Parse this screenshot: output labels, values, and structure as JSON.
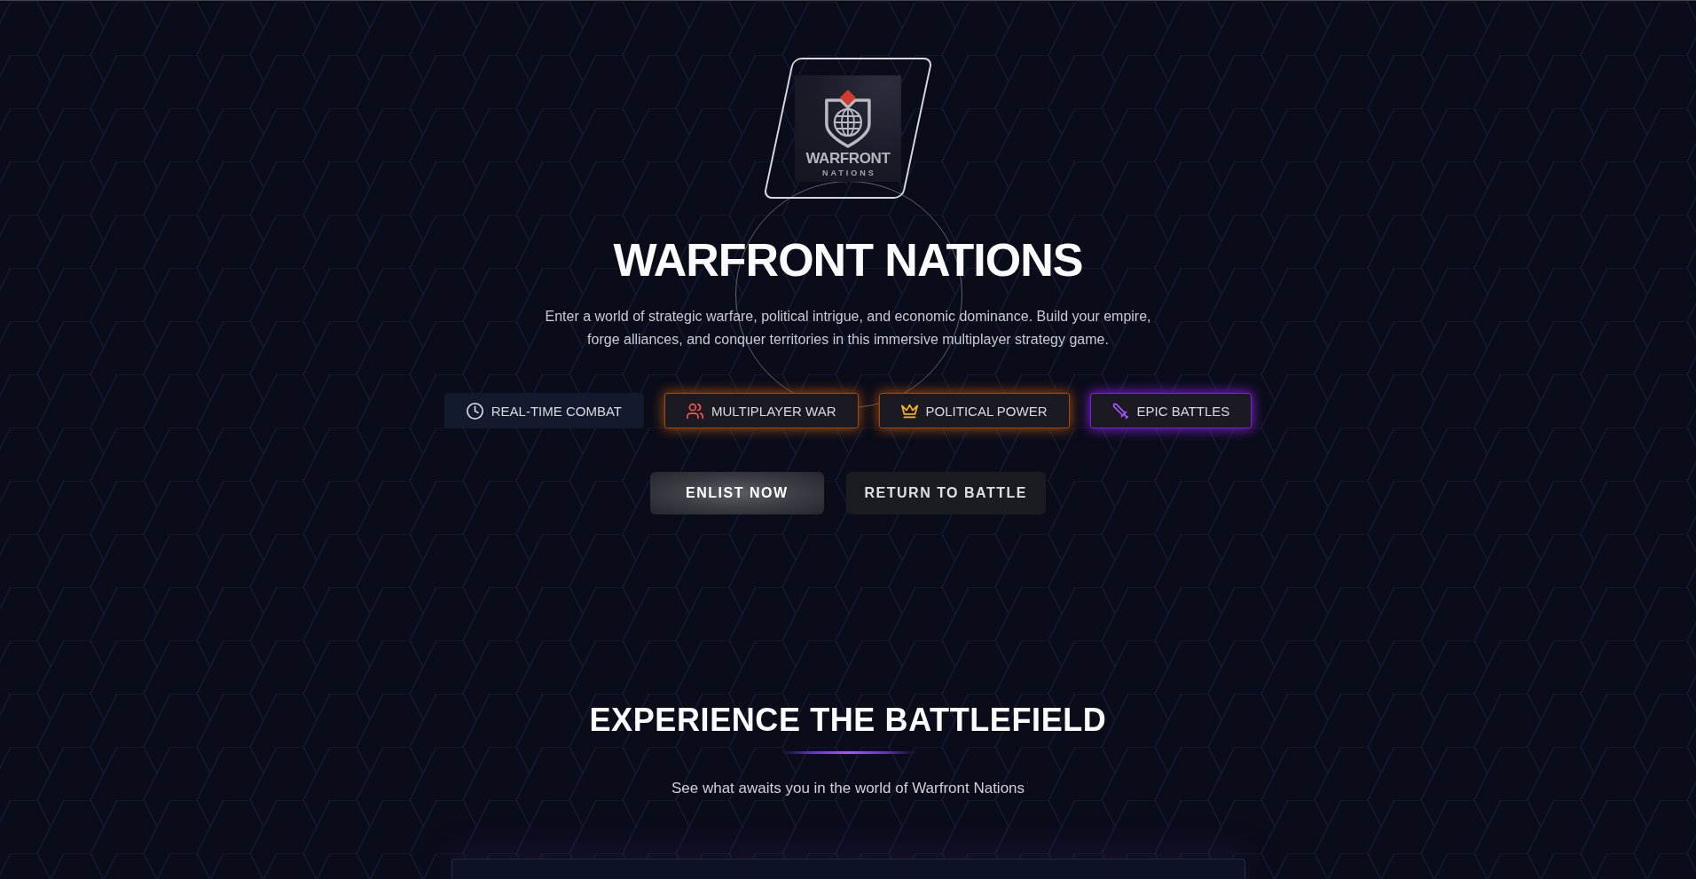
{
  "logo": {
    "wordmark": "WARFRONT",
    "tagline": "NATIONS"
  },
  "hero": {
    "title": "WARFRONT NATIONS",
    "description": "Enter a world of strategic warfare, political intrigue, and economic dominance. Build your empire, forge alliances, and conquer territories in this immersive multiplayer strategy game.",
    "features": [
      {
        "label": "REAL-TIME COMBAT",
        "color": "#d4d5de"
      },
      {
        "label": "MULTIPLAYER WAR",
        "color": "#f0584c",
        "glow": {
          "color": "#9a4a12"
        }
      },
      {
        "label": "POLITICAL POWER",
        "color": "#f5b21a",
        "glow": {
          "color": "#9a4a12"
        }
      },
      {
        "label": "EPIC BATTLES",
        "color": "#a855f7",
        "glow": {
          "color": "#7e22ce"
        }
      }
    ],
    "buttons": [
      {
        "label": "ENLIST NOW",
        "kind": "primary"
      },
      {
        "label": "RETURN TO BATTLE",
        "kind": "secondary"
      }
    ]
  },
  "experience": {
    "title": "EXPERIENCE THE BATTLEFIELD",
    "subtitle": "See what awaits you in the world of Warfront Nations"
  }
}
